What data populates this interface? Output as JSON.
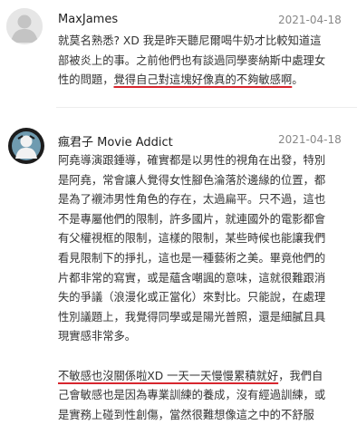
{
  "comments": [
    {
      "author": "MaxJames",
      "date": "2021-04-18",
      "avatar_icon": "default-user-icon",
      "lines": [
        {
          "pre": "就莫名熟悉? XD 我是昨天聽尼爾喝牛奶才比較知道這",
          "hl": "",
          "post": ""
        },
        {
          "pre": "部被炎上的事。之前他們也有談過同學麥納斯中處理女",
          "hl": "",
          "post": ""
        },
        {
          "pre": "性的問題，",
          "hl": "覺得自己對這塊好像真的不夠敏感啊",
          "post": "。"
        }
      ]
    },
    {
      "author": "瘋君子 Movie Addict",
      "date": "2021-04-18",
      "avatar_icon": "profile-avatar-icon",
      "lines": [
        {
          "pre": "阿堯導演跟鍾導，確實都是以男性的視角在出發，特別",
          "hl": "",
          "post": ""
        },
        {
          "pre": "是阿堯，常會讓人覺得女性腳色淪落於邊緣的位置，都",
          "hl": "",
          "post": ""
        },
        {
          "pre": "是為了襯沛男性角色的存在，太過扁平。只不過，這也",
          "hl": "",
          "post": ""
        },
        {
          "pre": "不是專屬他們的限制，許多國片，就連國外的電影都會",
          "hl": "",
          "post": ""
        },
        {
          "pre": "有父權視框的限制，這樣的限制，某些時候也能讓我們",
          "hl": "",
          "post": ""
        },
        {
          "pre": "看見限制下的掙扎，這也是一種藝術之美。畢竟他們的",
          "hl": "",
          "post": ""
        },
        {
          "pre": "片都非常的寫實，或是蘊含嘲諷的意味，這就很難跟消",
          "hl": "",
          "post": ""
        },
        {
          "pre": "失的爭議（浪漫化或正當化）來對比。只能說，在處理",
          "hl": "",
          "post": ""
        },
        {
          "pre": "性別議題上，我覺得同學或是陽光普照，還是細膩且具",
          "hl": "",
          "post": ""
        },
        {
          "pre": "現實感非常多。",
          "hl": "",
          "post": ""
        },
        {
          "pre": "",
          "hl": "",
          "post": ""
        },
        {
          "pre": "",
          "hl": "不敏感也沒關係啦XD 一天一天慢慢累積就好",
          "post": "，我們自"
        },
        {
          "pre": "己會敏感也是因為專業訓練的養成，沒有經過訓練，或",
          "hl": "",
          "post": ""
        },
        {
          "pre": "是實務上碰到性創傷，當然很難想像這之中的不舒服",
          "hl": "",
          "post": ""
        }
      ]
    }
  ]
}
